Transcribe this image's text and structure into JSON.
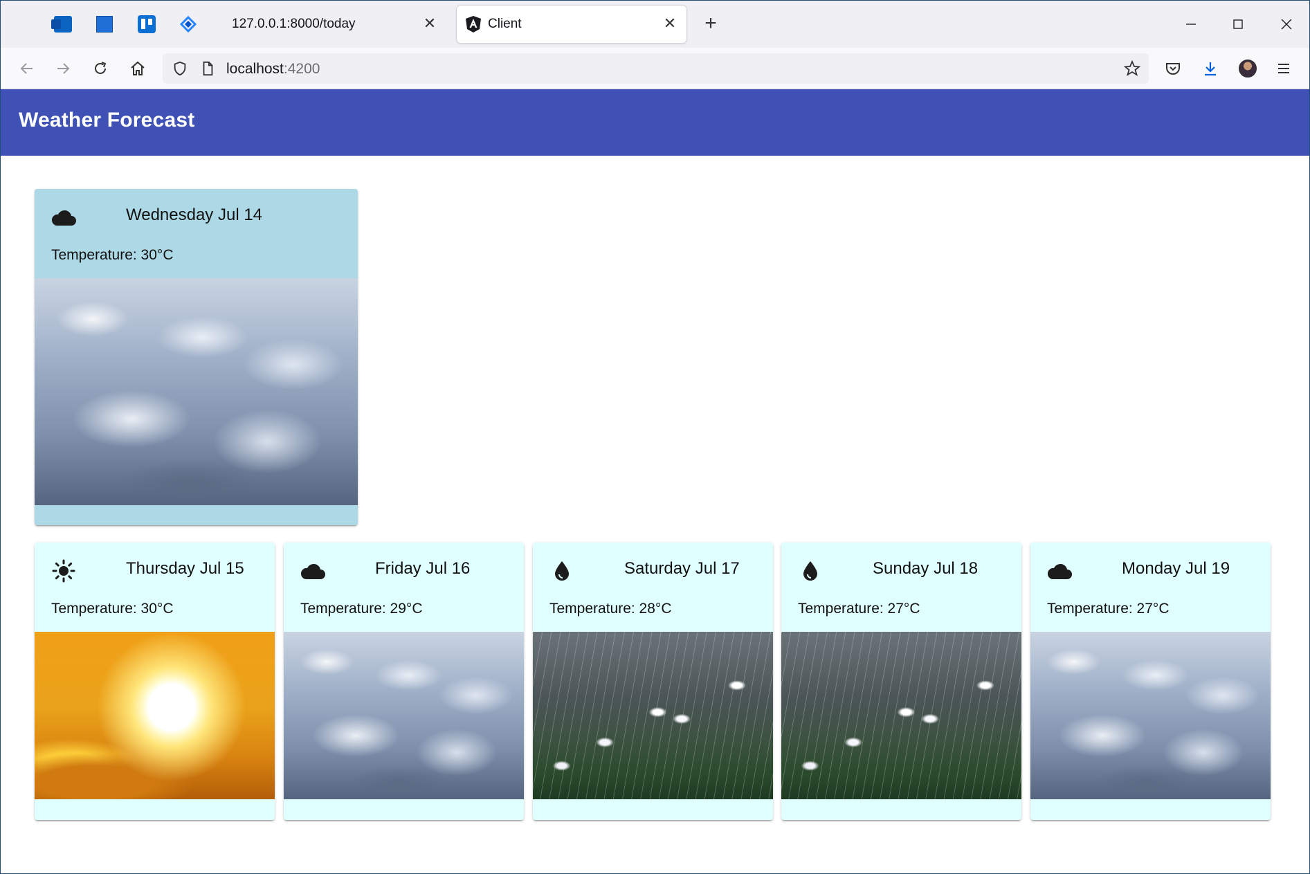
{
  "browser": {
    "tabs": [
      {
        "title": "127.0.0.1:8000/today"
      },
      {
        "title": "Client"
      }
    ],
    "url": {
      "host": "localhost",
      "port": ":4200"
    }
  },
  "app": {
    "title": "Weather Forecast"
  },
  "colors": {
    "toolbar": "#3f51b5",
    "today_card": "#add8e6",
    "day_card": "#e0ffff"
  },
  "today": {
    "icon": "cloud-icon",
    "date": "Wednesday Jul 14",
    "temperature": "Temperature: 30°C",
    "image": "clouds"
  },
  "forecast": [
    {
      "icon": "sun-icon",
      "date": "Thursday Jul 15",
      "temperature": "Temperature: 30°C",
      "image": "sun"
    },
    {
      "icon": "cloud-icon",
      "date": "Friday Jul 16",
      "temperature": "Temperature: 29°C",
      "image": "clouds"
    },
    {
      "icon": "raindrop-icon",
      "date": "Saturday Jul 17",
      "temperature": "Temperature: 28°C",
      "image": "rain"
    },
    {
      "icon": "raindrop-icon",
      "date": "Sunday Jul 18",
      "temperature": "Temperature: 27°C",
      "image": "rain"
    },
    {
      "icon": "cloud-icon",
      "date": "Monday Jul 19",
      "temperature": "Temperature: 27°C",
      "image": "clouds"
    }
  ]
}
